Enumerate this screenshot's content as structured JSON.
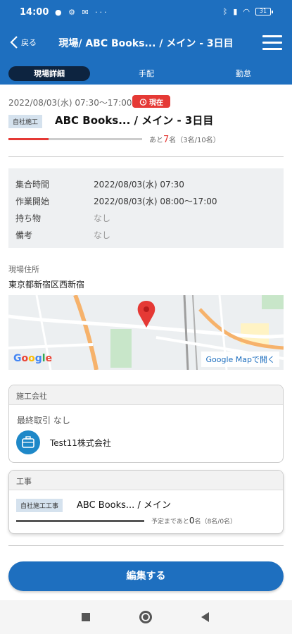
{
  "status_bar": {
    "time": "14:00",
    "indicators": "● ⚙ ✉ ···",
    "battery": "31"
  },
  "header": {
    "back_label": "戻る",
    "title": "現場/ ABC Books... / メイン - 3日目"
  },
  "tabs": [
    {
      "label": "現場詳細",
      "active": true
    },
    {
      "label": "手配",
      "active": false
    },
    {
      "label": "勤怠",
      "active": false
    }
  ],
  "site": {
    "datetime": "2022/08/03(水) 07:30〜17:00",
    "now_label": "現在",
    "tag": "自社施工",
    "title": "ABC Books... / メイン - 3日目",
    "progress_fraction": 0.3,
    "remaining_prefix": "あと",
    "remaining_count": "7",
    "remaining_suffix": "名（3名/10名）"
  },
  "details": [
    {
      "label": "集合時間",
      "value": "2022/08/03(水) 07:30",
      "muted": false
    },
    {
      "label": "作業開始",
      "value": "2022/08/03(水) 08:00〜17:00",
      "muted": false
    },
    {
      "label": "持ち物",
      "value": "なし",
      "muted": true
    },
    {
      "label": "備考",
      "value": "なし",
      "muted": true
    }
  ],
  "address": {
    "label": "現場住所",
    "value": "東京都新宿区西新宿"
  },
  "map": {
    "open_label": "Google Mapで開く",
    "logo": "Google"
  },
  "company": {
    "header": "施工会社",
    "last_deal": "最終取引 なし",
    "name": "Test11株式会社"
  },
  "work": {
    "header": "工事",
    "tag": "自社施工工事",
    "title": "ABC Books... / メイン",
    "remaining_prefix": "予定まであと",
    "remaining_count": "0",
    "remaining_suffix": "名（8名/0名）",
    "progress_fraction": 1.0
  },
  "edit_button": "編集する",
  "colors": {
    "primary": "#1e6fbf",
    "alert": "#e53935",
    "tab_active": "#0d2440"
  }
}
